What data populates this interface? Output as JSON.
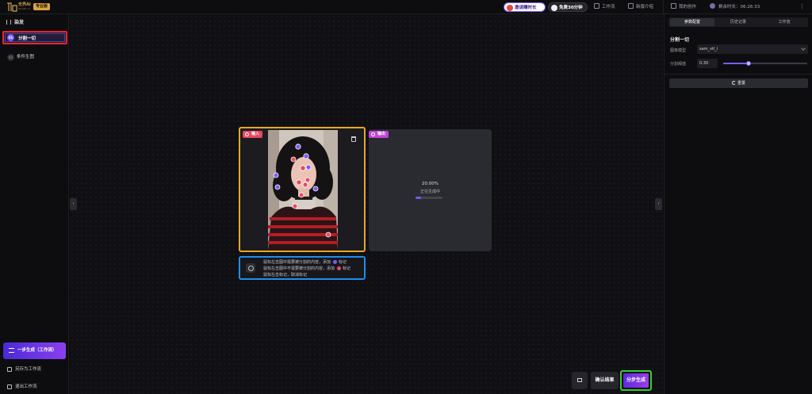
{
  "topbar": {
    "brand": "无界AI",
    "brand_sub": "WUJIE AI",
    "pro_badge": "专业版",
    "invite_label": "邀请赚时长",
    "free_label": "免费30分钟",
    "workflow_label": "工作流",
    "guide_label": "新版介绍",
    "my_creations": "我的创作",
    "remaining_time": "剩余时长：06:26:33"
  },
  "sidebar": {
    "title": "染发",
    "steps": [
      {
        "num": "01",
        "label": "分割一切"
      },
      {
        "num": "02",
        "label": "条件生图"
      }
    ],
    "onestep_label": "一步生成（工作流）",
    "save_workflow": "另存为工作流",
    "exit_workflow": "退出工作流"
  },
  "canvas": {
    "input_tag": "输入",
    "output_tag": "输出",
    "progress_text": "20.00%",
    "progress_status": "正在生成中",
    "progress_fraction": 0.2,
    "hints": [
      {
        "text": "鼠标左击图中需要被分割的内容，添加",
        "tag": "标记",
        "color": "#7a5cff"
      },
      {
        "text": "鼠标左击图中不需要被分割的内容，添加",
        "tag": "标记",
        "color": "#e84a6a"
      },
      {
        "text": "鼠标左击标记，取消标记",
        "tag": "",
        "color": ""
      }
    ],
    "confirm_label": "确认结果",
    "stepgen_label": "分步生成"
  },
  "right_panel": {
    "tabs": [
      "参数配置",
      "历史记录",
      "工作流"
    ],
    "section_title": "分割一切",
    "model_label": "图像模型",
    "model_value": "sam_vit_l",
    "threshold_label": "分割阈值",
    "threshold_value": "0.30",
    "threshold_fraction": 0.3,
    "reset_label": "重置"
  },
  "colors": {
    "accent": "#7a5cff",
    "input_border": "#e6a824",
    "hint_border": "#1e8ff0",
    "selected_step_border": "#e8262b",
    "stepgen_border": "#33d02f"
  }
}
